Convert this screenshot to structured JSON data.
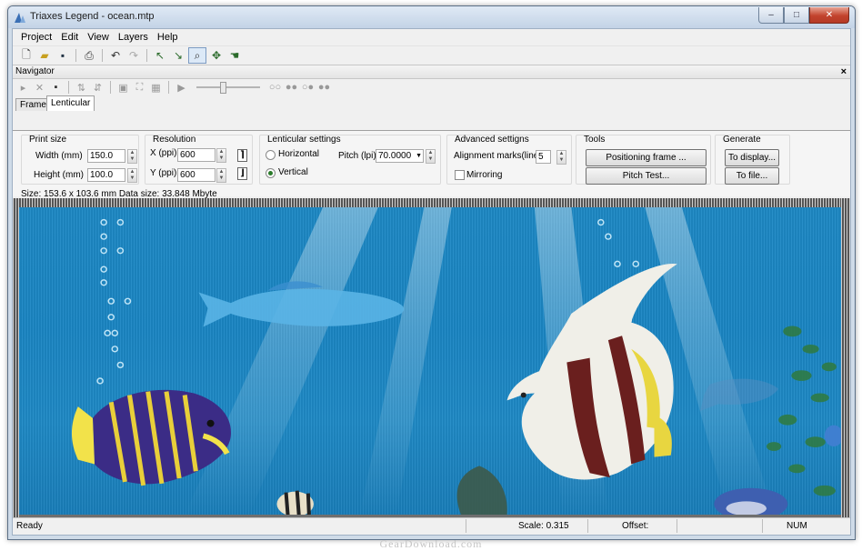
{
  "window": {
    "title": "Triaxes Legend - ocean.mtp"
  },
  "menu": [
    "Project",
    "Edit",
    "View",
    "Layers",
    "Help"
  ],
  "toolbar": {
    "icons": [
      "new-file-icon",
      "open-folder-icon",
      "save-icon",
      "print-preview-icon",
      "undo-icon",
      "redo-icon",
      "select-arrow-icon",
      "pointer-tool-icon",
      "zoom-tool-icon",
      "pan-tool-icon",
      "hand-tool-icon"
    ]
  },
  "navigator": {
    "title": "Navigator",
    "close_label": "×",
    "slider_value": 0.4
  },
  "tabs": [
    {
      "label": "Frames",
      "active": false
    },
    {
      "label": "Lenticular",
      "active": true
    }
  ],
  "print_size": {
    "title": "Print size",
    "width_label": "Width  (mm)",
    "width_value": "150.0",
    "height_label": "Height  (mm)",
    "height_value": "100.0"
  },
  "resolution": {
    "title": "Resolution",
    "x_label": "X (ppi)",
    "x_value": "600",
    "y_label": "Y (ppi)",
    "y_value": "600"
  },
  "lenticular": {
    "title": "Lenticular settings",
    "horizontal_label": "Horizontal",
    "vertical_label": "Vertical",
    "selected": "Vertical",
    "pitch_label": "Pitch (lpi)",
    "pitch_value": "70.0000"
  },
  "advanced": {
    "title": "Advanced settigns",
    "marks_label": "Alignment marks(lines)",
    "marks_value": "5",
    "mirroring_label": "Mirroring",
    "mirroring_checked": false
  },
  "tools": {
    "title": "Tools",
    "positioning_label": "Positioning frame ...",
    "pitch_test_label": "Pitch Test..."
  },
  "generate": {
    "title": "Generate",
    "display_label": "To display...",
    "file_label": "To file..."
  },
  "size_info": "Size: 153.6 x 103.6 mm  Data size: 33.848 Mbyte",
  "status": {
    "ready": "Ready",
    "scale": "Scale:  0.315",
    "offset": "Offset:",
    "num": "NUM"
  },
  "watermark": "GearDownload.com",
  "colors": {
    "ocean": "#1d89c5",
    "titlebar": "#c3d3e6",
    "close_button": "#c2432d"
  }
}
